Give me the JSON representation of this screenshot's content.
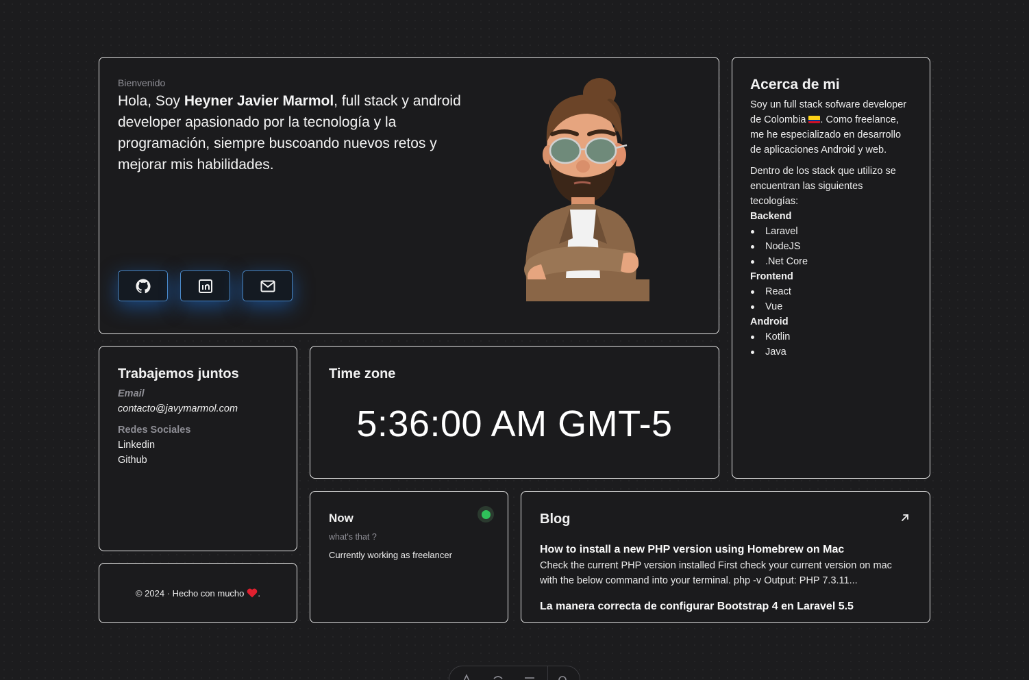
{
  "intro": {
    "label": "Bienvenido",
    "greeting": "Hola, Soy ",
    "name": "Heyner Javier Marmol",
    "description": ", full stack y android developer apasionado por la tecnología y la programación, siempre buscoando nuevos retos y mejorar mis habilidades.",
    "social": [
      {
        "name": "github-icon"
      },
      {
        "name": "linkedin-icon"
      },
      {
        "name": "mail-icon"
      }
    ]
  },
  "about": {
    "title": "Acerca de mi",
    "paragraph1": "Soy un full stack sofware developer de Colombia",
    "paragraph1_end": ". Como freelance, me he especializado en desarrollo de aplicaciones Android y web.",
    "paragraph2": "Dentro de los stack que utilizo se encuentran las siguientes tecologías:",
    "stacks": [
      {
        "heading": "Backend",
        "items": [
          "Laravel",
          "NodeJS",
          ".Net Core"
        ]
      },
      {
        "heading": "Frontend",
        "items": [
          "React",
          "Vue"
        ]
      },
      {
        "heading": "Android",
        "items": [
          "Kotlin",
          "Java"
        ]
      }
    ]
  },
  "contact": {
    "title": "Trabajemos juntos",
    "email_label": "Email",
    "email": "contacto@javymarmol.com",
    "social_label": "Redes Sociales",
    "links": [
      "Linkedin",
      "Github"
    ]
  },
  "timezone": {
    "title": "Time zone",
    "time": "5:36:00 AM GMT-5"
  },
  "footer": {
    "text": "© 2024 · Hecho con mucho",
    "end": "."
  },
  "now": {
    "title": "Now",
    "subtitle": "what's that ?",
    "status": "Currently working as freelancer",
    "status_color": "#2fc15a"
  },
  "blog": {
    "title": "Blog",
    "posts": [
      {
        "title": "How to install a new PHP version using Homebrew on Mac",
        "excerpt": "Check the current PHP version installed First check your current version on mac with the below command into your terminal. php -v Output: PHP 7.3.11..."
      },
      {
        "title": "La manera correcta de configurar Bootstrap 4 en Laravel 5.5"
      }
    ]
  },
  "colors": {
    "background": "#1c1c1e",
    "card_border": "#e9e9e9",
    "accent_blue": "#4a89c8"
  }
}
